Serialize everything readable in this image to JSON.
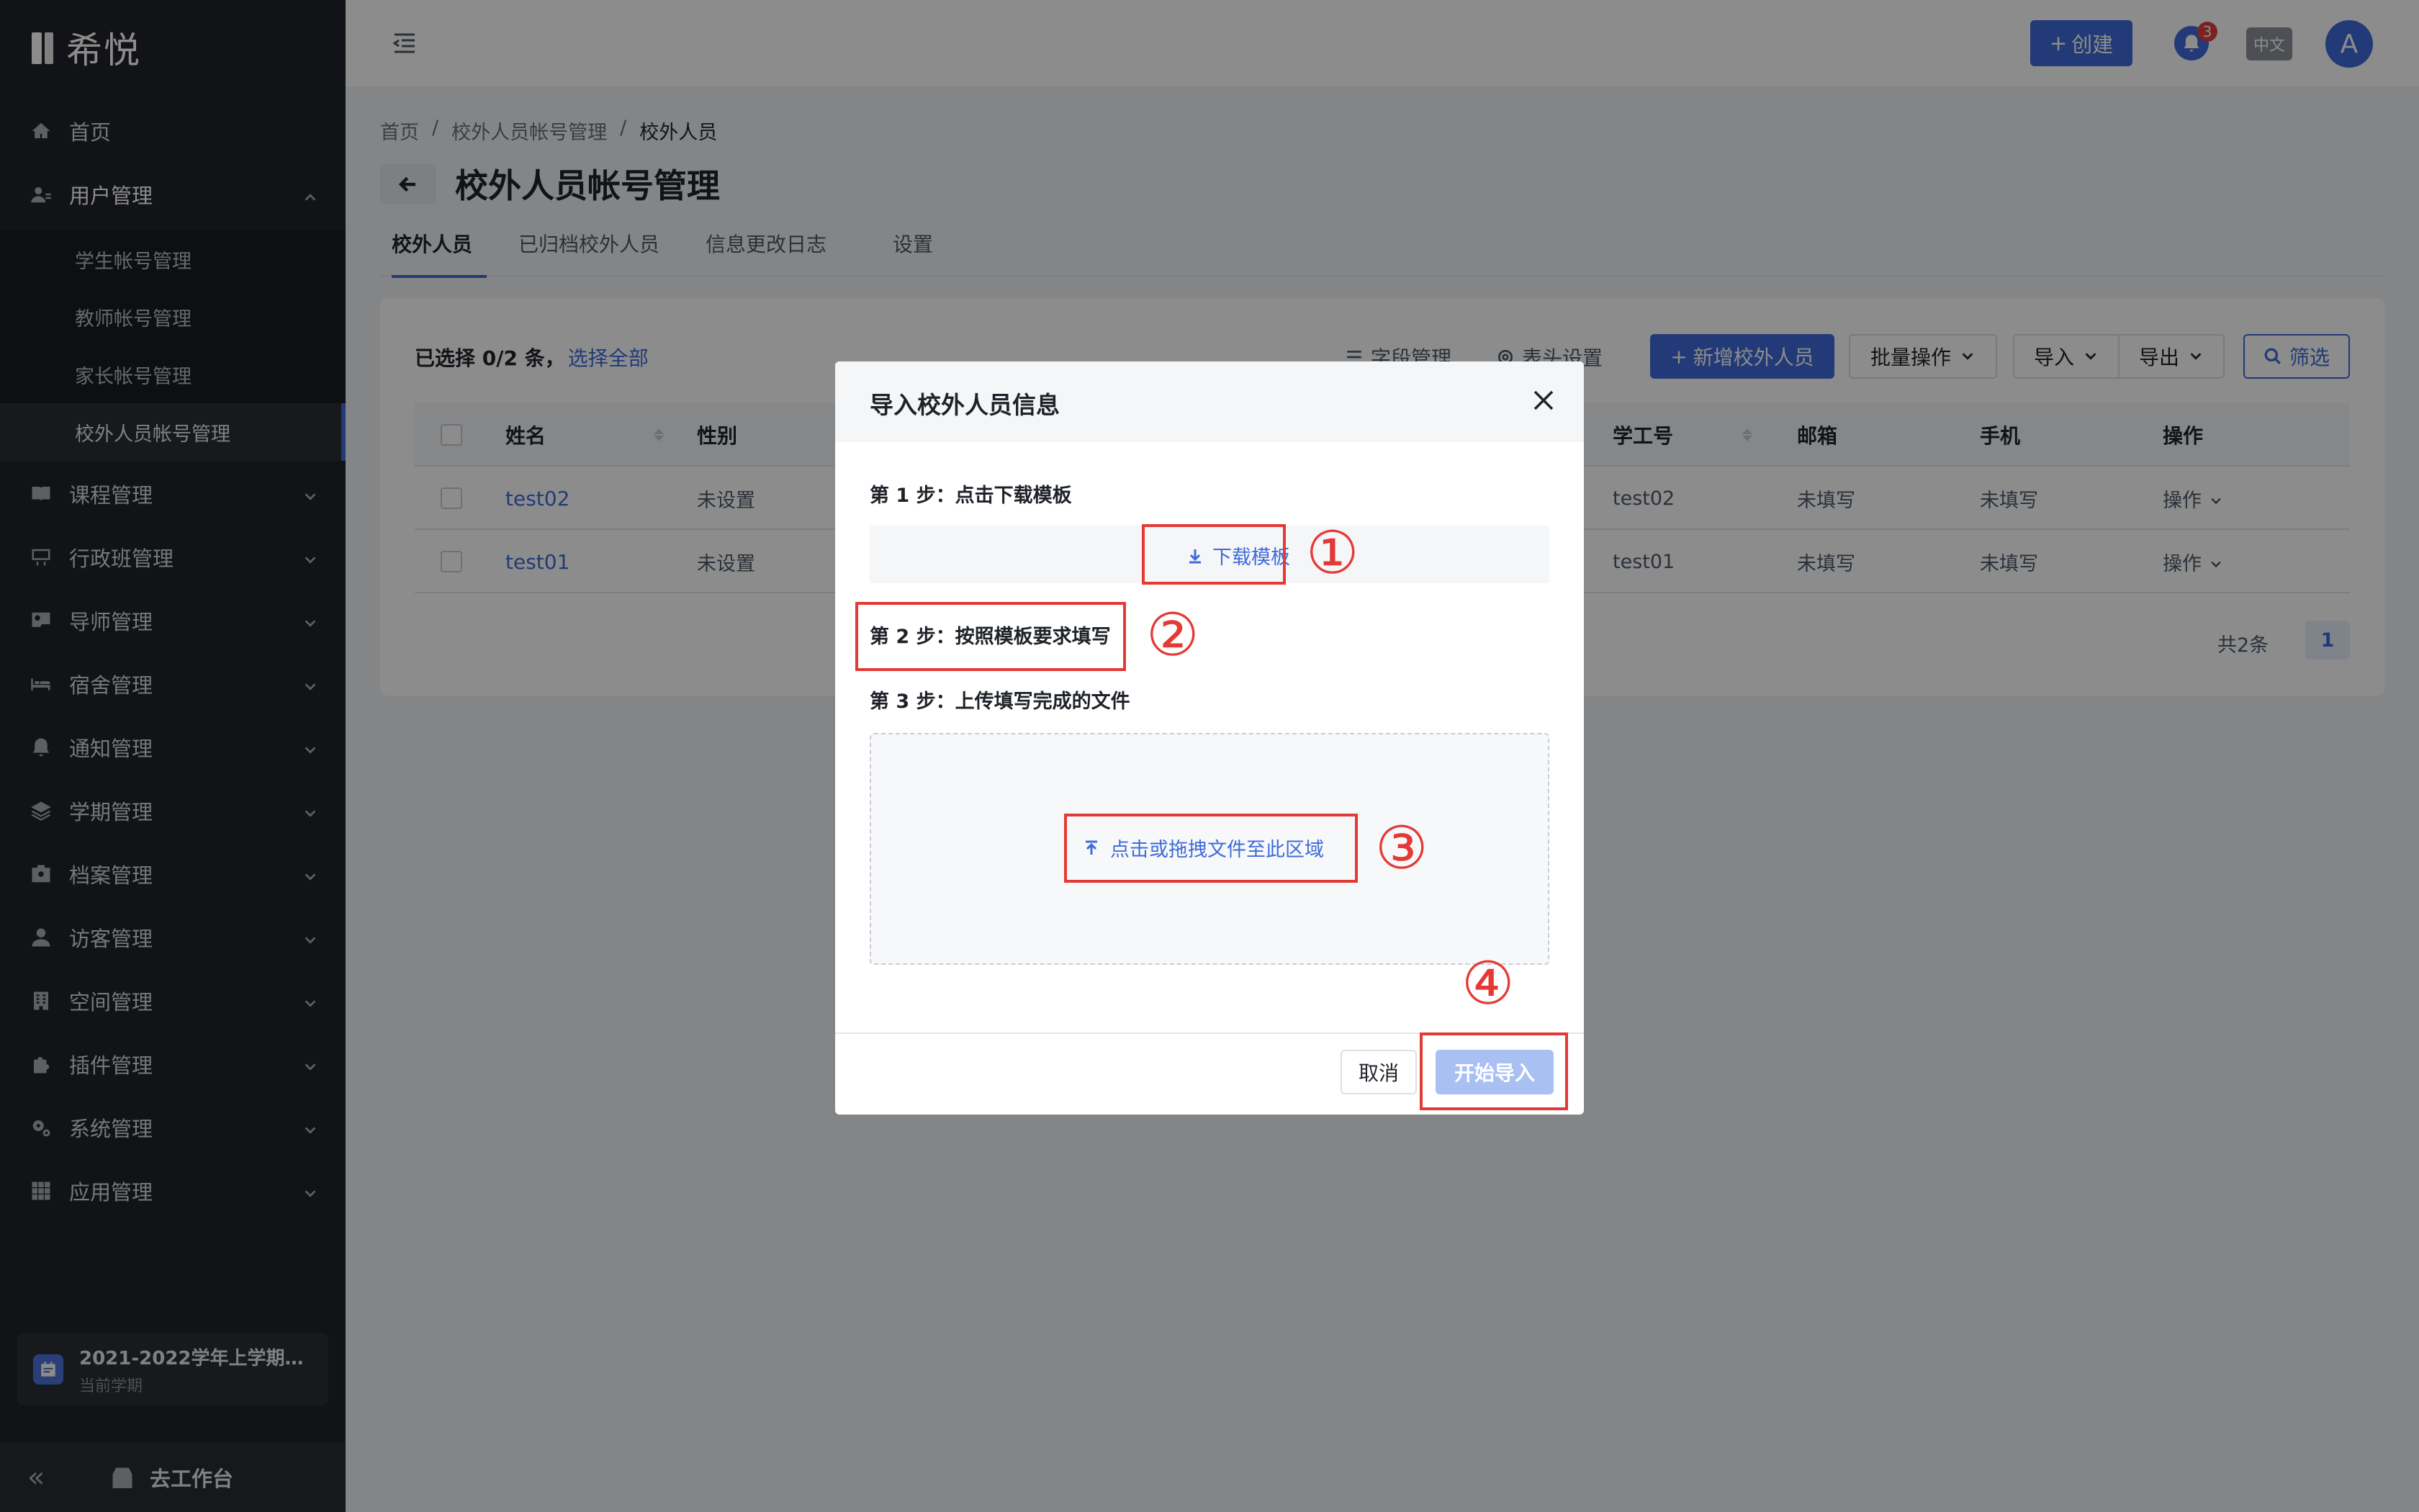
{
  "app": {
    "logo_text": "希悦"
  },
  "sidebar": {
    "items": [
      {
        "label": "首页",
        "icon": "home-icon"
      },
      {
        "label": "用户管理",
        "icon": "user-manage-icon",
        "expanded": true
      },
      {
        "label": "课程管理",
        "icon": "book-icon"
      },
      {
        "label": "行政班管理",
        "icon": "class-icon"
      },
      {
        "label": "导师管理",
        "icon": "mentor-icon"
      },
      {
        "label": "宿舍管理",
        "icon": "bed-icon"
      },
      {
        "label": "通知管理",
        "icon": "bell-icon"
      },
      {
        "label": "学期管理",
        "icon": "layers-icon"
      },
      {
        "label": "档案管理",
        "icon": "archive-icon"
      },
      {
        "label": "访客管理",
        "icon": "visitor-icon"
      },
      {
        "label": "空间管理",
        "icon": "building-icon"
      },
      {
        "label": "插件管理",
        "icon": "puzzle-icon"
      },
      {
        "label": "系统管理",
        "icon": "gear-icon"
      },
      {
        "label": "应用管理",
        "icon": "grid-icon"
      }
    ],
    "sub_items": [
      {
        "label": "学生帐号管理"
      },
      {
        "label": "教师帐号管理"
      },
      {
        "label": "家长帐号管理"
      },
      {
        "label": "校外人员帐号管理",
        "active": true
      }
    ],
    "term": {
      "name": "2021-2022学年上学期（...",
      "sub": "当前学期"
    },
    "collapse_glyph": "«",
    "workbench_label": "去工作台"
  },
  "header": {
    "create_label": "创建",
    "notification_count": "3",
    "lang_label": "中文",
    "avatar_letter": "A"
  },
  "breadcrumb": [
    "首页",
    "校外人员帐号管理",
    "校外人员"
  ],
  "breadcrumb_sep": "/",
  "page_title": "校外人员帐号管理",
  "tabs": [
    {
      "label": "校外人员",
      "active": true
    },
    {
      "label": "已归档校外人员"
    },
    {
      "label": "信息更改日志"
    },
    {
      "label": "设置"
    }
  ],
  "toolbar": {
    "selection_text": "已选择 0/2 条，",
    "select_all": "选择全部",
    "field_manage": "字段管理",
    "header_settings": "表头设置",
    "add_label": "新增校外人员",
    "batch_label": "批量操作",
    "import_label": "导入",
    "export_label": "导出",
    "filter_label": "筛选"
  },
  "table": {
    "columns": [
      "姓名",
      "性别",
      "学工号",
      "邮箱",
      "手机",
      "操作"
    ],
    "rows": [
      {
        "name": "test02",
        "gender": "未设置",
        "id": "test02",
        "email": "未填写",
        "phone": "未填写",
        "op": "操作"
      },
      {
        "name": "test01",
        "gender": "未设置",
        "id": "test01",
        "email": "未填写",
        "phone": "未填写",
        "op": "操作"
      }
    ]
  },
  "pagination": {
    "total": "共2条",
    "page": "1"
  },
  "modal": {
    "title": "导入校外人员信息",
    "step1": "第 1 步：点击下载模板",
    "download_label": "下载模板",
    "step2": "第 2 步：按照模板要求填写",
    "step3": "第 3 步：上传填写完成的文件",
    "upload_label": "点击或拖拽文件至此区域",
    "cancel_label": "取消",
    "start_label": "开始导入"
  },
  "annotations": [
    "①",
    "②",
    "③",
    "④"
  ],
  "colors": {
    "accent": "#3f6bd9",
    "annotation": "#e53935",
    "sidebar_bg": "#212329"
  }
}
